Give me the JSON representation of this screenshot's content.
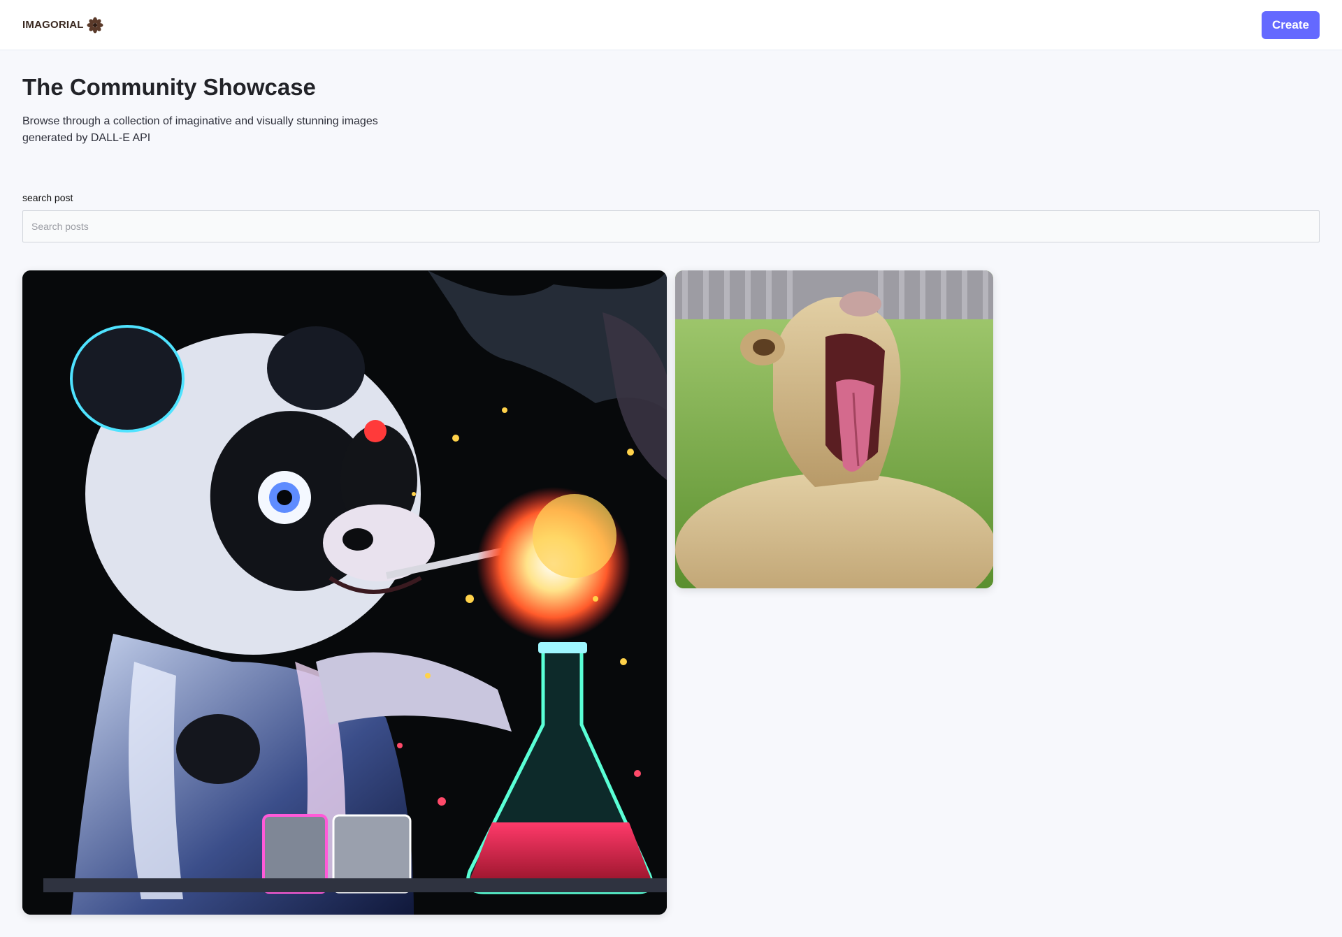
{
  "header": {
    "logo_text": "IMAGORIAL",
    "logo_icon": "flower-icon",
    "create_label": "Create"
  },
  "main": {
    "title": "The Community Showcase",
    "description": "Browse through a collection of imaginative and visually stunning images generated by DALL-E API",
    "search_label": "search post",
    "search_placeholder": "Search posts",
    "search_value": ""
  },
  "posts": [
    {
      "name": "panda-scientist-image"
    },
    {
      "name": "yawning-lioness-image"
    }
  ],
  "colors": {
    "accent": "#6469ff",
    "background": "#f7f8fc",
    "header_bg": "#ffffff",
    "title": "#222328"
  }
}
